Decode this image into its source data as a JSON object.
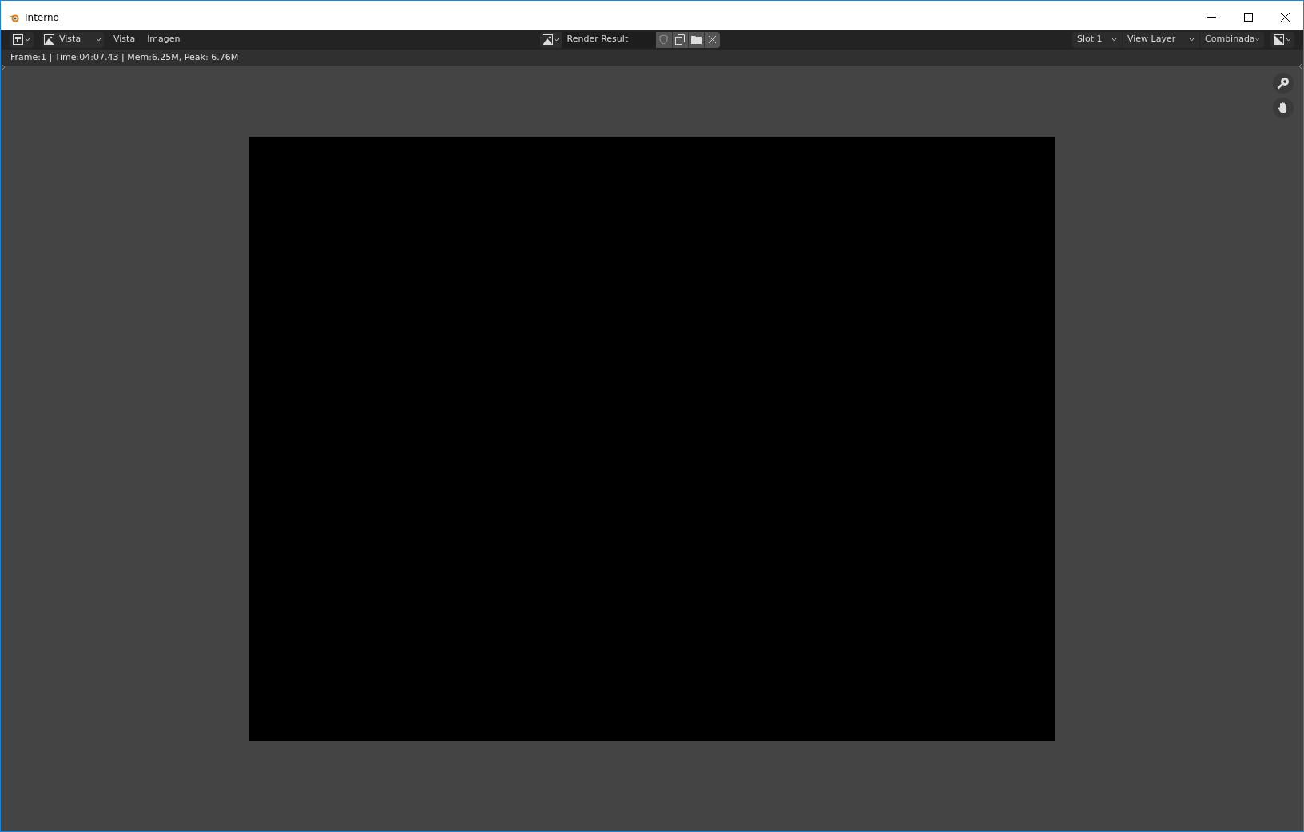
{
  "window": {
    "title": "Interno"
  },
  "header": {
    "view_dropdown": "Vista",
    "menus": [
      "Vista",
      "Imagen"
    ],
    "image_name": "Render Result",
    "slot": "Slot 1",
    "view_layer": "View Layer",
    "pass": "Combinada"
  },
  "render_info": "Frame:1 | Time:04:07.43 | Mem:6.25M, Peak: 6.76M"
}
